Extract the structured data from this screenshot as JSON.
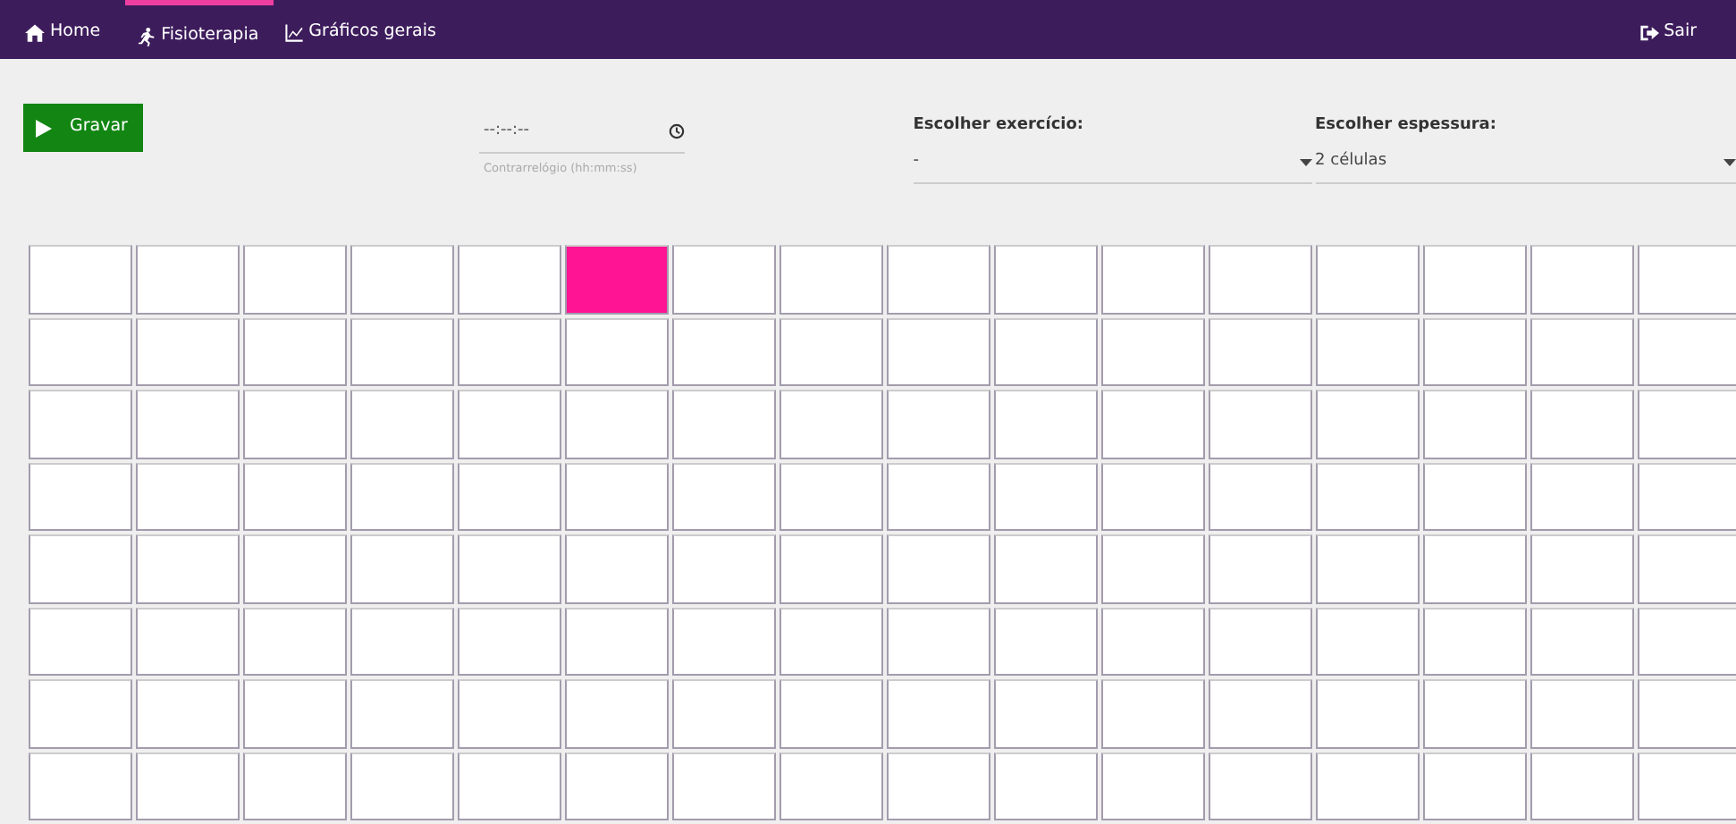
{
  "navbar": {
    "items": [
      {
        "kind": "home",
        "label": "Home",
        "selected": false
      },
      {
        "kind": "run",
        "label": "Fisioterapia",
        "selected": true
      },
      {
        "kind": "chart",
        "label": "Gráficos gerais",
        "selected": false
      }
    ],
    "logout": {
      "label": "Sair"
    }
  },
  "controls": {
    "record_button": "Gravar",
    "timer": {
      "placeholder": "--:--:--",
      "helper": "Contrarrelógio (hh:mm:ss)"
    },
    "selects": [
      {
        "label": "Escolher exercício:",
        "value": "-"
      },
      {
        "label": "Escolher espessura:",
        "value": "2 células"
      }
    ]
  },
  "grid": {
    "rows": [
      {
        "cells": [
          {
            "on": false
          },
          {
            "on": false
          },
          {
            "on": false
          },
          {
            "on": false
          },
          {
            "on": false
          },
          {
            "on": true
          },
          {
            "on": false
          },
          {
            "on": false
          },
          {
            "on": false
          },
          {
            "on": false
          },
          {
            "on": false
          },
          {
            "on": false
          },
          {
            "on": false
          },
          {
            "on": false
          },
          {
            "on": false
          },
          {
            "on": false
          }
        ]
      },
      {
        "cells": [
          {
            "on": false
          },
          {
            "on": false
          },
          {
            "on": false
          },
          {
            "on": false
          },
          {
            "on": false
          },
          {
            "on": false
          },
          {
            "on": false
          },
          {
            "on": false
          },
          {
            "on": false
          },
          {
            "on": false
          },
          {
            "on": false
          },
          {
            "on": false
          },
          {
            "on": false
          },
          {
            "on": false
          },
          {
            "on": false
          },
          {
            "on": false
          }
        ]
      },
      {
        "cells": [
          {
            "on": false
          },
          {
            "on": false
          },
          {
            "on": false
          },
          {
            "on": false
          },
          {
            "on": false
          },
          {
            "on": false
          },
          {
            "on": false
          },
          {
            "on": false
          },
          {
            "on": false
          },
          {
            "on": false
          },
          {
            "on": false
          },
          {
            "on": false
          },
          {
            "on": false
          },
          {
            "on": false
          },
          {
            "on": false
          },
          {
            "on": false
          }
        ]
      },
      {
        "cells": [
          {
            "on": false
          },
          {
            "on": false
          },
          {
            "on": false
          },
          {
            "on": false
          },
          {
            "on": false
          },
          {
            "on": false
          },
          {
            "on": false
          },
          {
            "on": false
          },
          {
            "on": false
          },
          {
            "on": false
          },
          {
            "on": false
          },
          {
            "on": false
          },
          {
            "on": false
          },
          {
            "on": false
          },
          {
            "on": false
          },
          {
            "on": false
          }
        ]
      },
      {
        "cells": [
          {
            "on": false
          },
          {
            "on": false
          },
          {
            "on": false
          },
          {
            "on": false
          },
          {
            "on": false
          },
          {
            "on": false
          },
          {
            "on": false
          },
          {
            "on": false
          },
          {
            "on": false
          },
          {
            "on": false
          },
          {
            "on": false
          },
          {
            "on": false
          },
          {
            "on": false
          },
          {
            "on": false
          },
          {
            "on": false
          },
          {
            "on": false
          }
        ]
      },
      {
        "cells": [
          {
            "on": false
          },
          {
            "on": false
          },
          {
            "on": false
          },
          {
            "on": false
          },
          {
            "on": false
          },
          {
            "on": false
          },
          {
            "on": false
          },
          {
            "on": false
          },
          {
            "on": false
          },
          {
            "on": false
          },
          {
            "on": false
          },
          {
            "on": false
          },
          {
            "on": false
          },
          {
            "on": false
          },
          {
            "on": false
          },
          {
            "on": false
          }
        ]
      },
      {
        "cells": [
          {
            "on": false
          },
          {
            "on": false
          },
          {
            "on": false
          },
          {
            "on": false
          },
          {
            "on": false
          },
          {
            "on": false
          },
          {
            "on": false
          },
          {
            "on": false
          },
          {
            "on": false
          },
          {
            "on": false
          },
          {
            "on": false
          },
          {
            "on": false
          },
          {
            "on": false
          },
          {
            "on": false
          },
          {
            "on": false
          },
          {
            "on": false
          }
        ]
      },
      {
        "cells": [
          {
            "on": false
          },
          {
            "on": false
          },
          {
            "on": false
          },
          {
            "on": false
          },
          {
            "on": false
          },
          {
            "on": false
          },
          {
            "on": false
          },
          {
            "on": false
          },
          {
            "on": false
          },
          {
            "on": false
          },
          {
            "on": false
          },
          {
            "on": false
          },
          {
            "on": false
          },
          {
            "on": false
          },
          {
            "on": false
          },
          {
            "on": false
          }
        ]
      }
    ]
  }
}
